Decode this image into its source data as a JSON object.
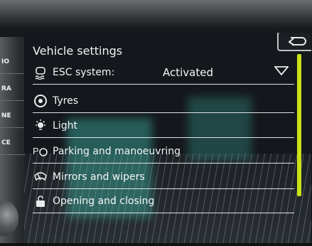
{
  "header": {
    "title": "Vehicle settings"
  },
  "side_buttons": [
    {
      "label": "IO"
    },
    {
      "label": "RA"
    },
    {
      "label": "NE"
    },
    {
      "label": "CE"
    }
  ],
  "menu": {
    "items": [
      {
        "label": "ESC system:",
        "value": "Activated",
        "icon": "esc-car-icon"
      },
      {
        "label": "Tyres",
        "icon": "tyre-icon"
      },
      {
        "label": "Light",
        "icon": "light-icon"
      },
      {
        "label": "Parking and manoeuvring",
        "icon": "parking-icon"
      },
      {
        "label": "Mirrors and wipers",
        "icon": "wiper-icon"
      },
      {
        "label": "Opening and closing",
        "icon": "lock-icon"
      }
    ]
  },
  "colors": {
    "accent_scroll": "#c9e21a",
    "text": "#f4f6f7"
  }
}
